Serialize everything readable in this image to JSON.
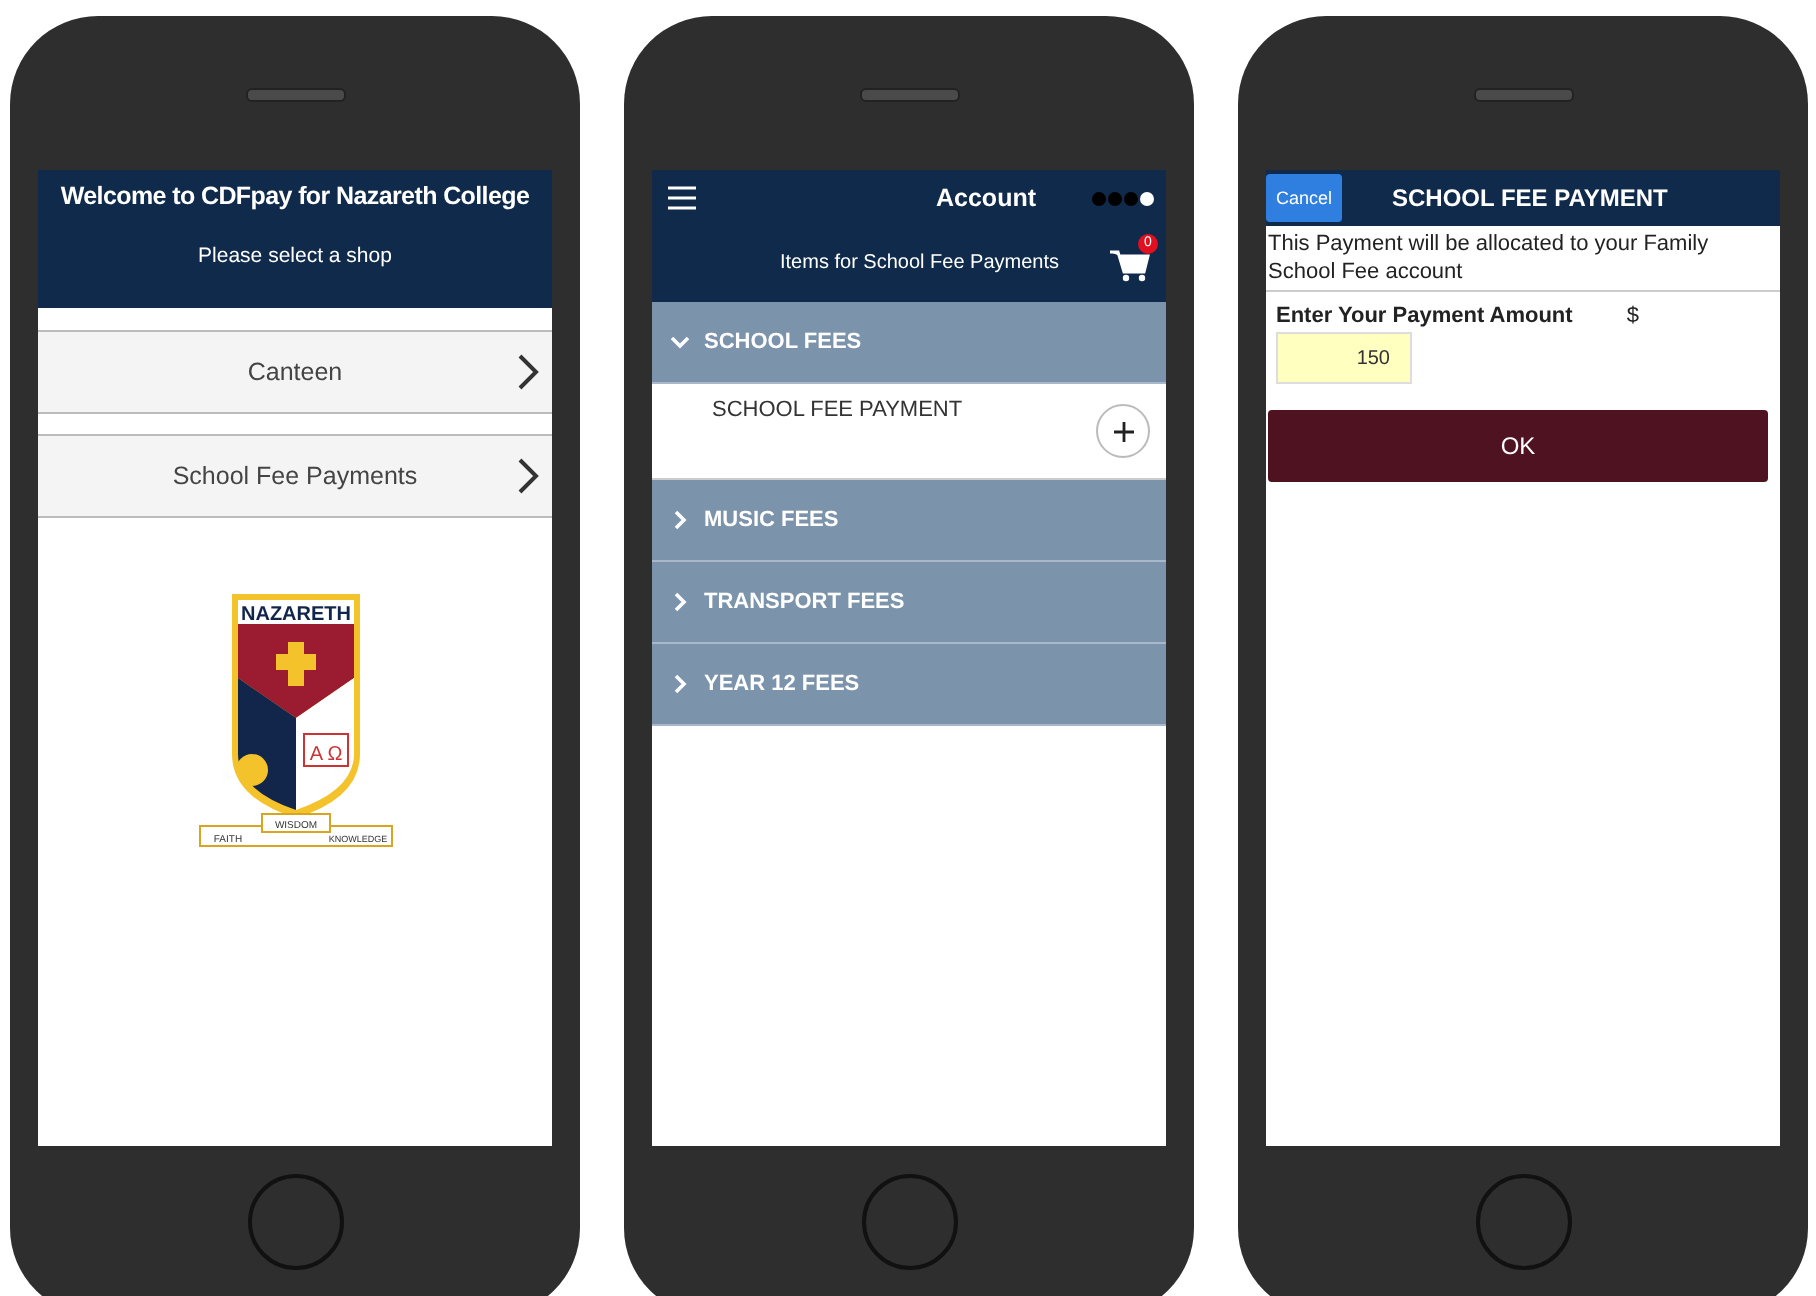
{
  "screens": [
    {
      "kind": "shops",
      "header": {
        "title": "Welcome to CDFpay for Nazareth College",
        "subtitle": "Please select a shop"
      },
      "shops": [
        "Canteen",
        "School Fee Payments"
      ],
      "logo": {
        "name": "NAZARETH",
        "symbols": "A Ω",
        "mottos": [
          "FAITH",
          "WISDOM",
          "KNOWLEDGE"
        ]
      }
    },
    {
      "kind": "items",
      "header": {
        "title": "Account",
        "subtitle": "Items for School Fee Payments",
        "cart_count": "0",
        "pages": [
          {
            "selected": false
          },
          {
            "selected": false
          },
          {
            "selected": false
          },
          {
            "selected": true
          }
        ]
      },
      "sections": [
        {
          "title": "SCHOOL FEES",
          "expanded": true,
          "items": [
            "SCHOOL FEE PAYMENT"
          ]
        },
        {
          "title": "MUSIC FEES",
          "expanded": false
        },
        {
          "title": "TRANSPORT FEES",
          "expanded": false
        },
        {
          "title": "YEAR 12 FEES",
          "expanded": false
        }
      ]
    },
    {
      "kind": "payment",
      "header": {
        "cancel": "Cancel",
        "title": "SCHOOL FEE PAYMENT"
      },
      "note": "This Payment will be allocated to your Family School Fee account",
      "amount_label": "Enter Your Payment Amount",
      "currency": "$",
      "amount": "150",
      "ok": "OK"
    }
  ]
}
